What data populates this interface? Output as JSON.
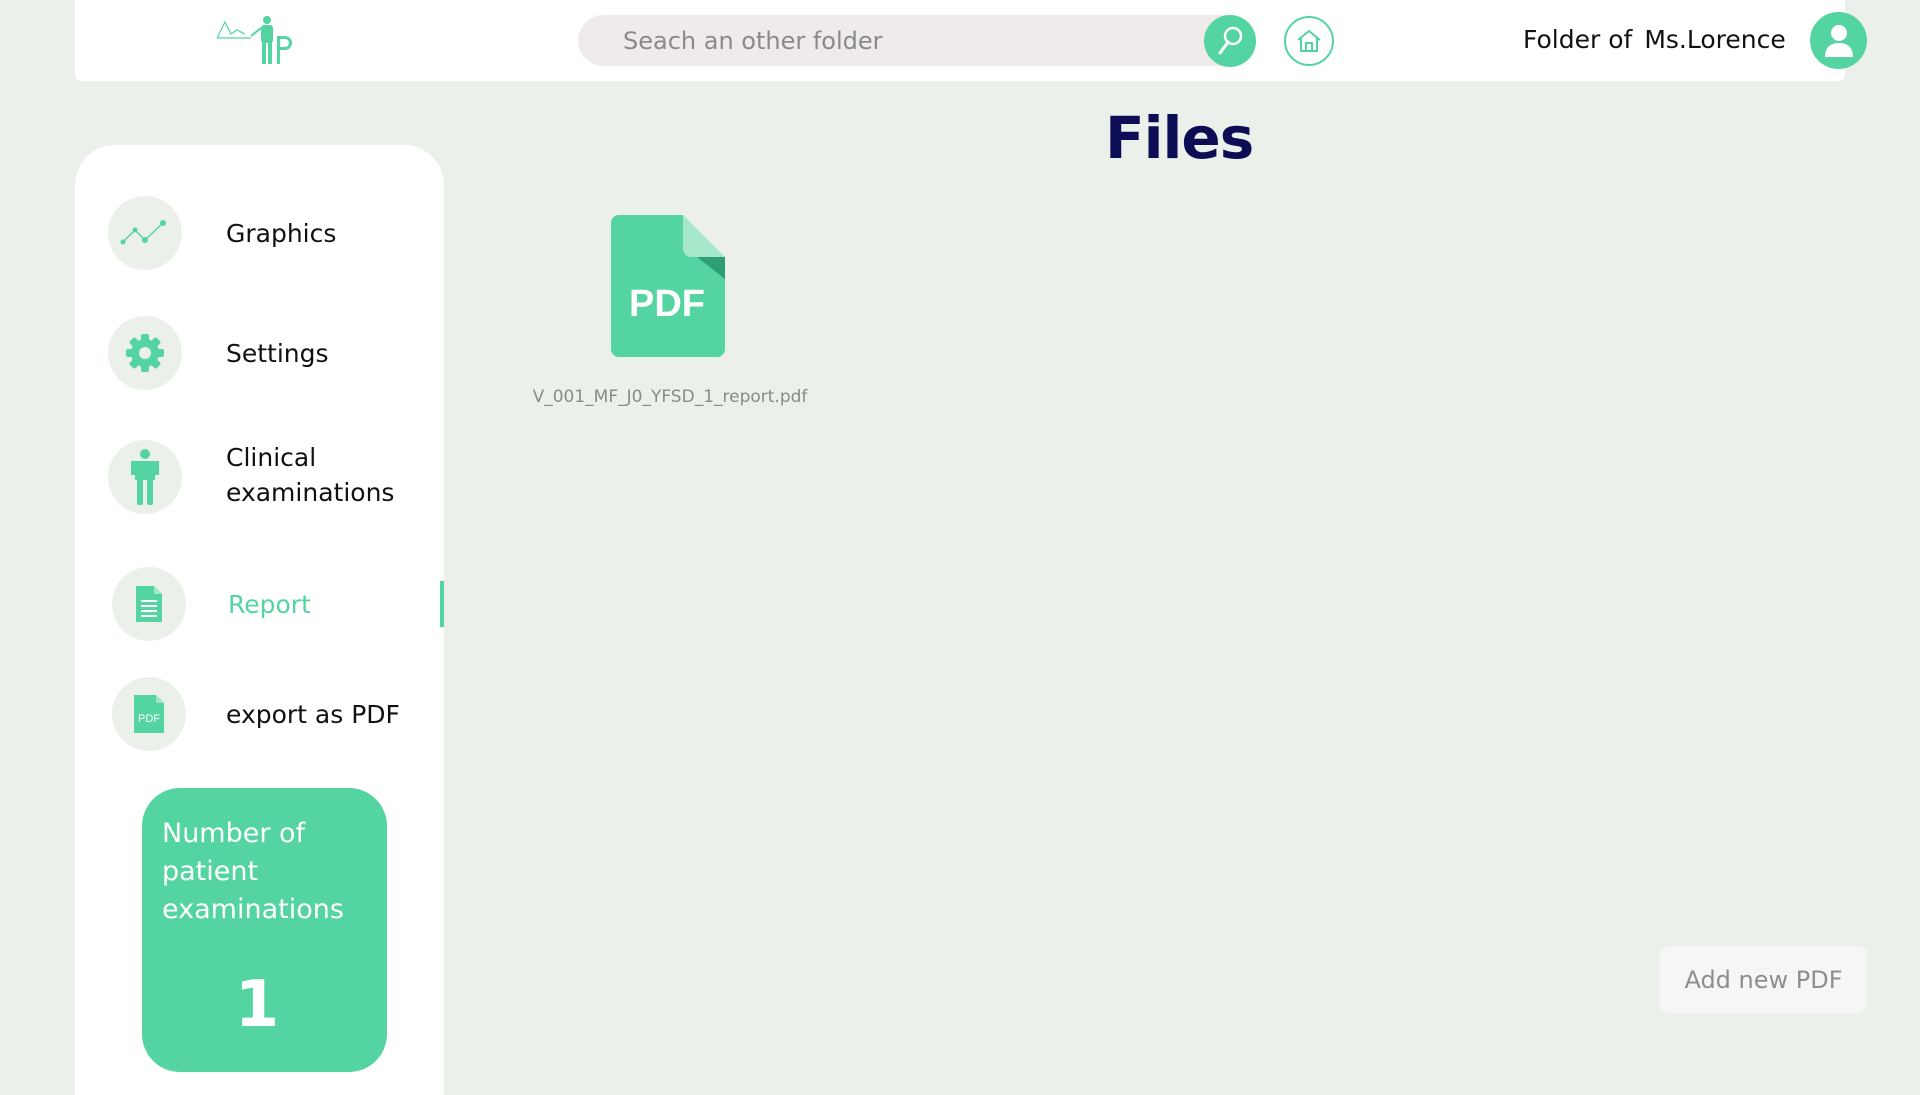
{
  "header": {
    "logo": "app-logo",
    "search": {
      "placeholder": "Seach an other folder",
      "value": ""
    },
    "folder_prefix": "Folder of",
    "patient_name": "Ms.Lorence"
  },
  "sidebar": {
    "items": [
      {
        "label": "Graphics",
        "icon": "line-chart-icon"
      },
      {
        "label": "Settings",
        "icon": "gear-icon"
      },
      {
        "label": "Clinical examinations",
        "icon": "person-icon"
      },
      {
        "label": "Report",
        "icon": "document-icon",
        "active": true
      },
      {
        "label": "export as PDF",
        "icon": "pdf-icon"
      }
    ],
    "stats": {
      "label": "Number of patient examinations",
      "value": "1"
    }
  },
  "main": {
    "title": "Files",
    "files": [
      {
        "icon_text": "PDF",
        "name": "V_001_MF_J0_YFSD_1_report.pdf"
      }
    ],
    "add_button": "Add new PDF"
  },
  "colors": {
    "accent": "#54d4a0",
    "background": "#ebf0ea",
    "title": "#0d0d55"
  }
}
